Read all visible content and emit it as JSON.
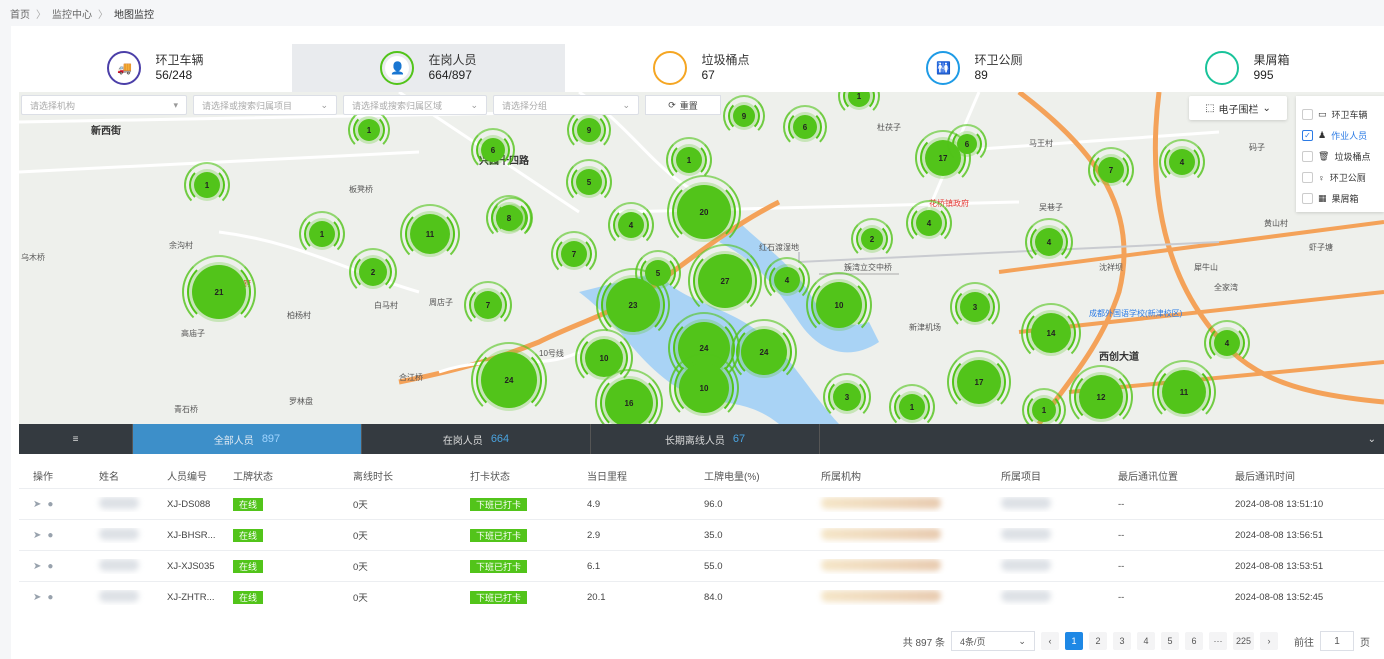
{
  "breadcrumb": [
    "首页",
    "监控中心",
    "地图监控"
  ],
  "stats": [
    {
      "label": "环卫车辆",
      "value": "56/248",
      "color": "#4b3fa8",
      "icon": "truck-icon",
      "glyph": "🚚"
    },
    {
      "label": "在岗人员",
      "value": "664/897",
      "color": "#52c41a",
      "icon": "person-icon",
      "glyph": "👤"
    },
    {
      "label": "垃圾桶点",
      "value": "67",
      "color": "#f5a623",
      "icon": "trash-icon",
      "glyph": "🗑"
    },
    {
      "label": "环卫公厕",
      "value": "89",
      "color": "#1e9be6",
      "icon": "toilet-icon",
      "glyph": "🚻"
    },
    {
      "label": "果屑箱",
      "value": "995",
      "color": "#19c39a",
      "icon": "box-icon",
      "glyph": "▦"
    }
  ],
  "filters": {
    "org": "请选择机构",
    "project": "请选择或搜索归属项目",
    "area": "请选择或搜索归属区域",
    "group": "请选择分组",
    "reset": "重置"
  },
  "fence_label": "电子围栏",
  "layers": [
    {
      "label": "环卫车辆",
      "checked": false
    },
    {
      "label": "作业人员",
      "checked": true
    },
    {
      "label": "垃圾桶点",
      "checked": false
    },
    {
      "label": "环卫公厕",
      "checked": false
    },
    {
      "label": "果屑箱",
      "checked": false
    }
  ],
  "map_labels": [
    {
      "text": "新西街"
    },
    {
      "text": "兴园十四路"
    },
    {
      "text": "板凳桥"
    },
    {
      "text": "余沟村"
    },
    {
      "text": "乌木桥"
    },
    {
      "text": "兴镇政府"
    },
    {
      "text": "高庙子"
    },
    {
      "text": "柏杨村"
    },
    {
      "text": "白马村"
    },
    {
      "text": "周店子"
    },
    {
      "text": "合江桥"
    },
    {
      "text": "罗林盘"
    },
    {
      "text": "青石桥"
    },
    {
      "text": "红石渡湿地"
    },
    {
      "text": "簇湾立交中桥"
    },
    {
      "text": "花桥镇政府"
    },
    {
      "text": "杜茯子"
    },
    {
      "text": "马王村"
    },
    {
      "text": "吴巷子"
    },
    {
      "text": "沈祥坝"
    },
    {
      "text": "犀牛山"
    },
    {
      "text": "全家湾"
    },
    {
      "text": "新津机场"
    },
    {
      "text": "成都外国语学校(新津校区)"
    },
    {
      "text": "西创大道"
    },
    {
      "text": "黄山村"
    },
    {
      "text": "虾子塘"
    },
    {
      "text": "10号线"
    },
    {
      "text": "码子"
    }
  ],
  "clusters": [
    "1",
    "6",
    "9",
    "9",
    "6",
    "1",
    "1",
    "5",
    "6",
    "1",
    "17",
    "7",
    "4",
    "1",
    "11",
    "8",
    "20",
    "6",
    "4",
    "4",
    "2",
    "7",
    "5",
    "27",
    "4",
    "4",
    "3",
    "21",
    "7",
    "23",
    "10",
    "2",
    "14",
    "10",
    "24",
    "24",
    "10",
    "24",
    "16",
    "3",
    "1",
    "17",
    "12",
    "11",
    "1",
    "4"
  ],
  "tabs": [
    {
      "label": "全部人员",
      "count": "897"
    },
    {
      "label": "在岗人员",
      "count": "664"
    },
    {
      "label": "长期离线人员",
      "count": "67"
    }
  ],
  "columns": [
    "操作",
    "姓名",
    "人员编号",
    "工牌状态",
    "离线时长",
    "打卡状态",
    "当日里程",
    "工牌电量(%)",
    "所属机构",
    "所属项目",
    "最后通讯位置",
    "最后通讯时间"
  ],
  "rows": [
    {
      "code": "XJ-DS088",
      "status": "在线",
      "offline": "0天",
      "punch": "下班已打卡",
      "mileage": "4.9",
      "battery": "96.0",
      "location": "--",
      "time": "2024-08-08 13:51:10"
    },
    {
      "code": "XJ-BHSR...",
      "status": "在线",
      "offline": "0天",
      "punch": "下班已打卡",
      "mileage": "2.9",
      "battery": "35.0",
      "location": "--",
      "time": "2024-08-08 13:56:51"
    },
    {
      "code": "XJ-XJS035",
      "status": "在线",
      "offline": "0天",
      "punch": "下班已打卡",
      "mileage": "6.1",
      "battery": "55.0",
      "location": "--",
      "time": "2024-08-08 13:53:51"
    },
    {
      "code": "XJ-ZHTR...",
      "status": "在线",
      "offline": "0天",
      "punch": "下班已打卡",
      "mileage": "20.1",
      "battery": "84.0",
      "location": "--",
      "time": "2024-08-08 13:52:45"
    }
  ],
  "pagination": {
    "total": "共 897 条",
    "page_size": "4条/页",
    "pages": [
      "1",
      "2",
      "3",
      "4",
      "5",
      "6",
      "···",
      "225"
    ],
    "goto_label": "前往",
    "goto_value": "1",
    "page_unit": "页"
  }
}
